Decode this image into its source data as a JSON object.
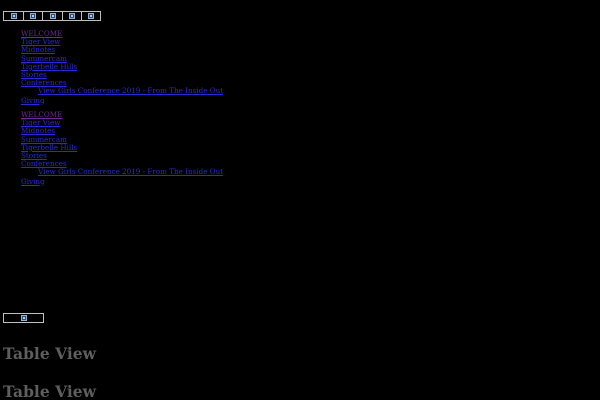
{
  "top_toolbar": {
    "icons": [
      "image-icon",
      "image-icon",
      "image-icon",
      "image-icon",
      "image-icon"
    ]
  },
  "menus": [
    {
      "items": [
        {
          "label": "WELCOME",
          "visited": true,
          "sub": false
        },
        {
          "label": "Tiger View",
          "visited": false,
          "sub": false
        },
        {
          "label": "Midnotes",
          "visited": false,
          "sub": false
        },
        {
          "label": "Summercam",
          "visited": false,
          "sub": false
        },
        {
          "label": "Tigerbelle Hills",
          "visited": false,
          "sub": false
        },
        {
          "label": "Stories",
          "visited": false,
          "sub": false
        },
        {
          "label": "Conferences",
          "visited": false,
          "sub": false
        },
        {
          "label": "View Girls Conference 2019 - From The Inside Out",
          "visited": false,
          "sub": true
        },
        {
          "label": "Giving",
          "visited": false,
          "sub": false
        }
      ]
    },
    {
      "items": [
        {
          "label": "WELCOME",
          "visited": true,
          "sub": false
        },
        {
          "label": "Tiger View",
          "visited": false,
          "sub": false
        },
        {
          "label": "Midnotes",
          "visited": false,
          "sub": false
        },
        {
          "label": "Summercam",
          "visited": false,
          "sub": false
        },
        {
          "label": "Tigerbelle Hills",
          "visited": false,
          "sub": false
        },
        {
          "label": "Stories",
          "visited": false,
          "sub": false
        },
        {
          "label": "Conferences",
          "visited": false,
          "sub": false
        },
        {
          "label": "View Girls Conference 2019 - From The Inside Out",
          "visited": false,
          "sub": true
        },
        {
          "label": "Giving",
          "visited": false,
          "sub": false
        }
      ]
    }
  ],
  "bottom_toolbar": {
    "icons": [
      "image-icon"
    ]
  },
  "headings": [
    "Table View",
    "Table View"
  ]
}
